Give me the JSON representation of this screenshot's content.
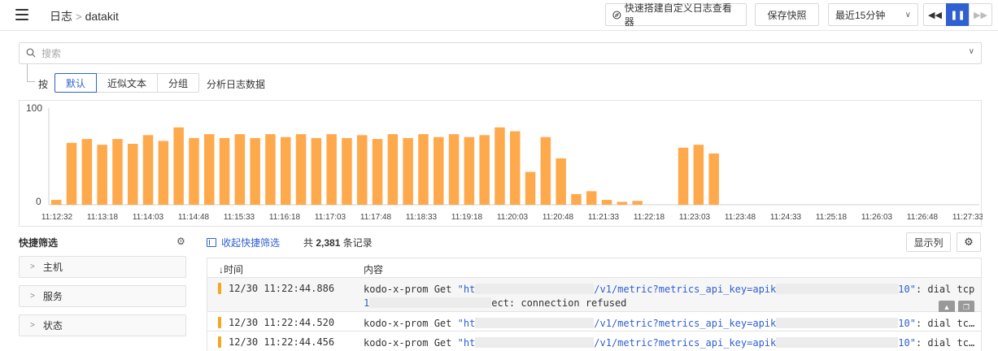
{
  "header": {
    "breadcrumb_root": "日志",
    "breadcrumb_sep": ">",
    "breadcrumb_current": "datakit",
    "quick_build_label": "快速搭建自定义日志查看器",
    "save_snapshot_label": "保存快照",
    "time_range_label": "最近15分钟",
    "time_range_caret": "∨",
    "ctrl_prev": "◀◀",
    "ctrl_pause": "❚❚",
    "ctrl_next": "▶▶"
  },
  "search": {
    "placeholder": "搜索",
    "chevron": "∨"
  },
  "group_by": {
    "prefix": "按",
    "options": [
      "默认",
      "近似文本",
      "分组"
    ],
    "selected": "默认",
    "suffix": "分析日志数据"
  },
  "chart_data": {
    "type": "bar",
    "color": "#ffa94d",
    "ylim": [
      0,
      100
    ],
    "y_ticks": [
      "100",
      "0"
    ],
    "x_tick_labels": [
      "11:12:32",
      "11:13:18",
      "11:14:03",
      "11:14:48",
      "11:15:33",
      "11:16:18",
      "11:17:03",
      "11:17:48",
      "11:18:33",
      "11:19:18",
      "11:20:03",
      "11:20:48",
      "11:21:33",
      "11:22:18",
      "11:23:03",
      "11:23:48",
      "11:24:33",
      "11:25:18",
      "11:26:03",
      "11:26:48",
      "11:27:33"
    ],
    "values": [
      5,
      64,
      68,
      62,
      68,
      63,
      72,
      66,
      80,
      69,
      73,
      69,
      73,
      69,
      73,
      70,
      73,
      69,
      73,
      69,
      72,
      68,
      73,
      69,
      73,
      70,
      73,
      70,
      72,
      80,
      76,
      34,
      70,
      48,
      11,
      14,
      5,
      3,
      4,
      0,
      0,
      59,
      62,
      53
    ]
  },
  "quick_filter": {
    "title": "快捷筛选",
    "gear_icon": "gear-icon",
    "items": [
      "主机",
      "服务",
      "状态"
    ],
    "item_arrow": ">"
  },
  "list_toolbar": {
    "collapse_label": "收起快捷筛选",
    "count_prefix": "共",
    "count_value": "2,381",
    "count_suffix": "条记录",
    "columns_label": "显示列",
    "settings_icon": "gear-icon"
  },
  "table": {
    "col_time": "↓时间",
    "col_content": "内容",
    "rows": [
      {
        "time": "12/30 11:22:44.886",
        "c_pre": "kodo-x-prom Get ",
        "c_url_a": "\"ht",
        "c_url_b": "/v1/metric?metrics_api_key=apik",
        "c_url_c": "10\"",
        "c_post": ": dial tcp",
        "c_line2_a": "1",
        "c_line2_b": "ect: connection refused"
      },
      {
        "time": "12/30 11:22:44.520",
        "c_pre": "kodo-x-prom Get ",
        "c_url_a": "\"ht",
        "c_url_b": "/v1/metric?metrics_api_key=apik",
        "c_url_c": "10\"",
        "c_post": ": dial tc…"
      },
      {
        "time": "12/30 11:22:44.456",
        "c_pre": "kodo-x-prom Get ",
        "c_url_a": "\"ht",
        "c_url_b": "/v1/metric?metrics_api_key=apik",
        "c_url_c": "10\"",
        "c_post": ": dial tc…"
      }
    ]
  }
}
